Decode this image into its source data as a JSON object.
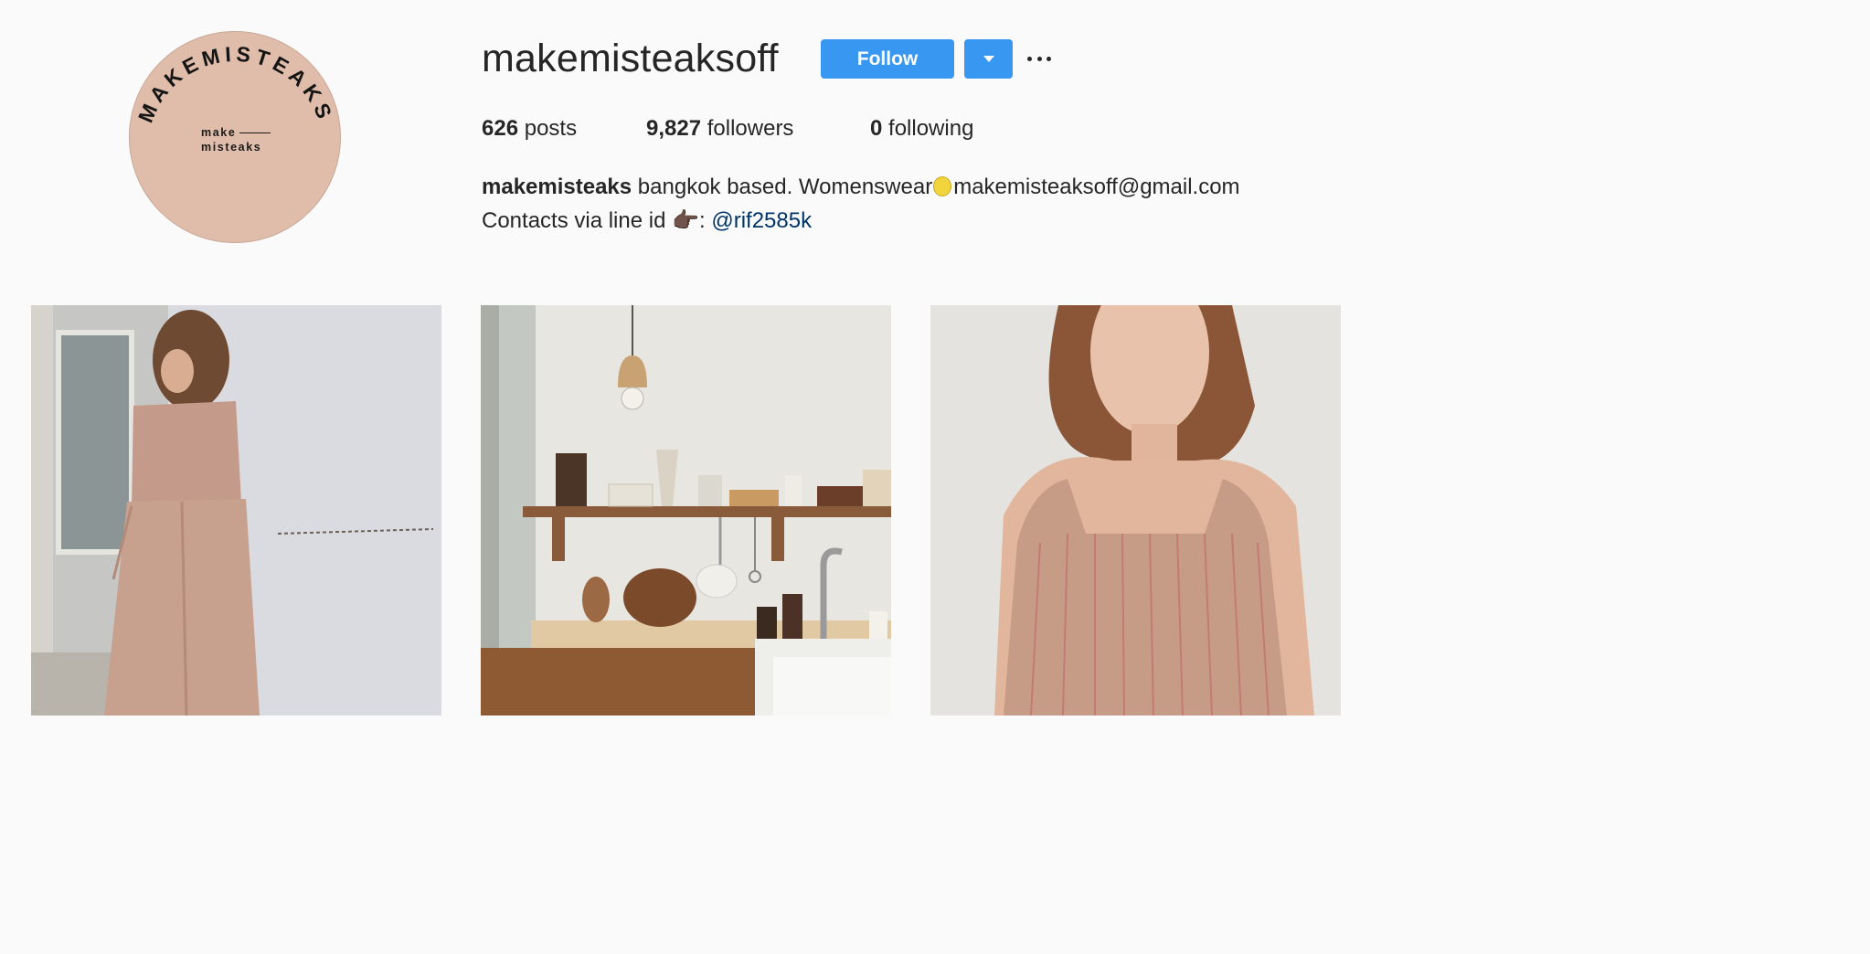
{
  "profile": {
    "username": "makemisteaksoff",
    "avatar": {
      "ring_text": "MAKEMISTEAKS",
      "line1": "make",
      "line2": "misteaks",
      "color": "#dfbdaa"
    }
  },
  "actions": {
    "follow_label": "Follow",
    "dropdown_icon": "chevron-down-icon",
    "more_icon": "ellipsis-icon",
    "accent": "#3897f0"
  },
  "stats": {
    "posts_count": "626",
    "posts_label": "posts",
    "followers_count": "9,827",
    "followers_label": "followers",
    "following_count": "0",
    "following_label": "following"
  },
  "bio": {
    "name": "makemisteaks",
    "text1": "bangkok based. Womenswear",
    "emoji1": "lemon-emoji",
    "text2": "makemisteaksoff@gmail.com",
    "text3": "Contacts via line id",
    "emoji2": "👉🏿",
    "colon": ":",
    "handle": "@rif2585k",
    "link_color": "#003569"
  },
  "posts": [
    {
      "subject": "model-in-pink-jumpsuit"
    },
    {
      "subject": "kitchen-shelf"
    },
    {
      "subject": "model-in-striped-top"
    }
  ]
}
